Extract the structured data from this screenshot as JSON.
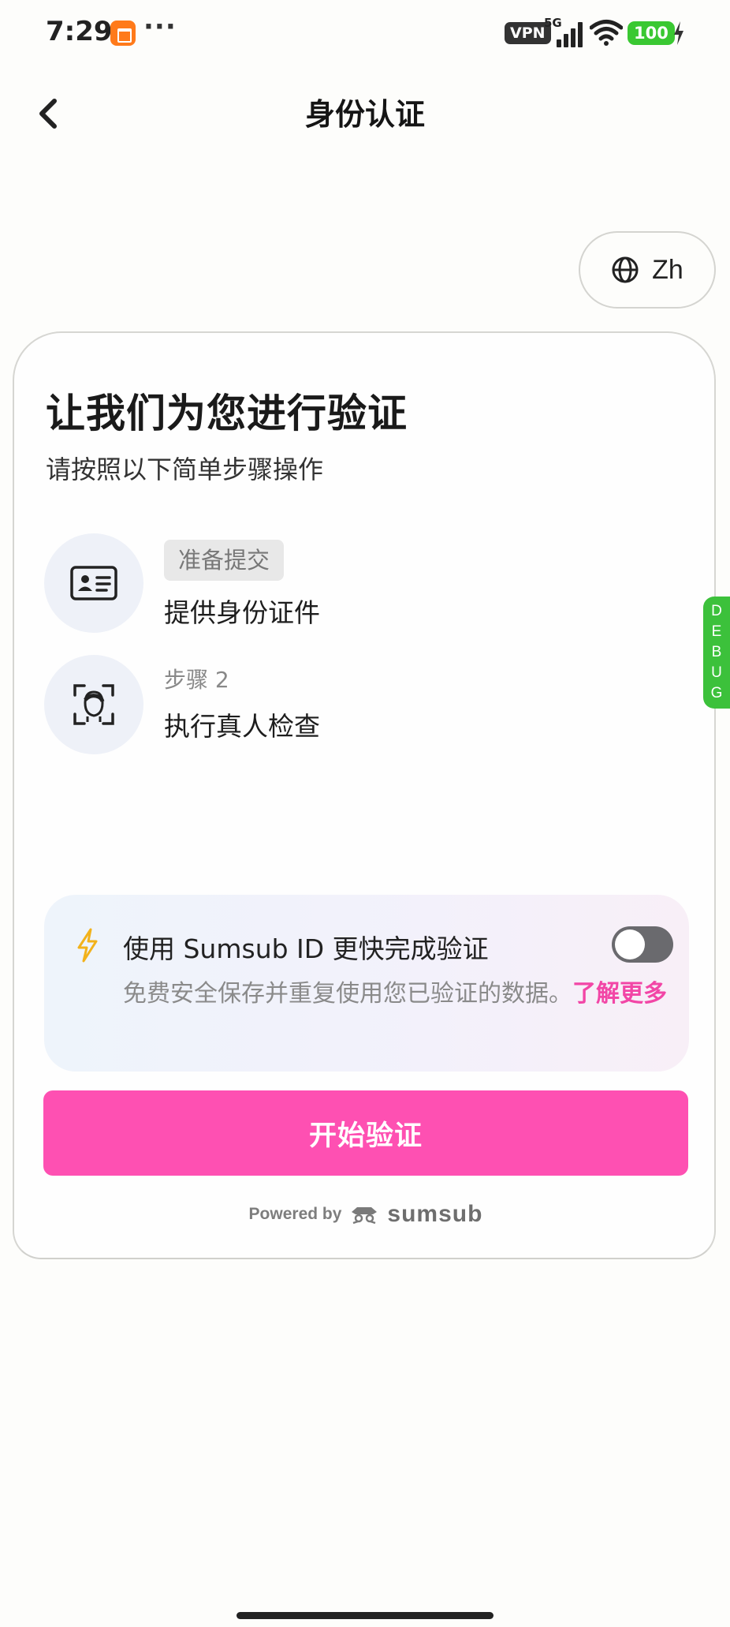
{
  "status_bar": {
    "time": "7:29",
    "more": "···",
    "vpn": "VPN",
    "network": "5G",
    "battery": "100"
  },
  "header": {
    "title": "身份认证",
    "back_icon": "chevron-left-icon"
  },
  "language": {
    "label": "Zh",
    "icon": "globe-icon"
  },
  "card": {
    "title": "让我们为您进行验证",
    "subtitle": "请按照以下简单步骤操作",
    "steps": [
      {
        "badge": "准备提交",
        "name": "提供身份证件",
        "icon": "id-card-icon"
      },
      {
        "label": "步骤 2",
        "name": "执行真人检查",
        "icon": "face-scan-icon"
      }
    ],
    "sumsub_id": {
      "title": "使用 Sumsub ID 更快完成验证",
      "description": "免费安全保存并重复使用您已验证的数据。",
      "learn_more": "了解更多",
      "toggle_on": false,
      "accent_color": "#f246a6",
      "icon": "lightning-icon"
    },
    "start_button": "开始验证",
    "start_color": "#fe50b2",
    "powered_by": "Powered by",
    "brand": "sumsub"
  },
  "debug": {
    "letters": [
      "D",
      "E",
      "B",
      "U",
      "G"
    ],
    "color": "#3cc13b"
  }
}
